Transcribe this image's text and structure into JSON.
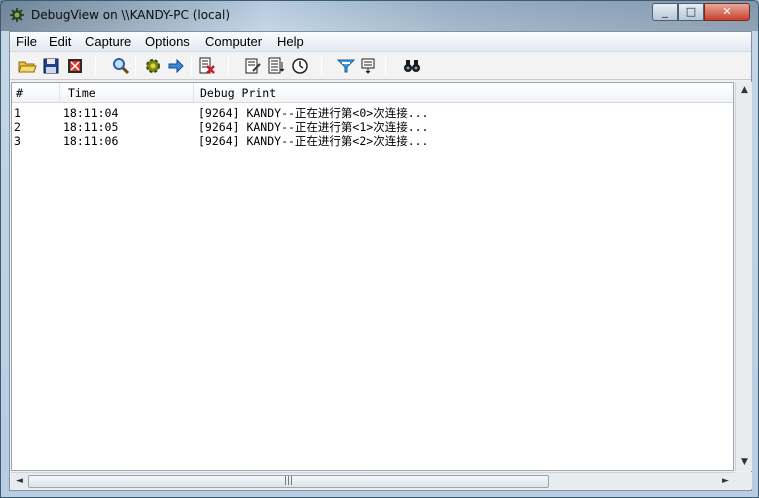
{
  "window": {
    "title": "DebugView on \\\\KANDY-PC (local)",
    "minimize": "0",
    "maximize": "1",
    "close": "r"
  },
  "menu": [
    "File",
    "Edit",
    "Capture",
    "Options",
    "Computer",
    "Help"
  ],
  "toolbar": {
    "icons": [
      "open-folder-icon",
      "save-icon",
      "clear-display-icon",
      "find-icon",
      "capture-settings-gear-icon",
      "autoscroll-arrow-icon",
      "clear-log-icon",
      "edit-filter-icon",
      "history-depth-icon",
      "time-clock-icon",
      "highlight-filter-icon",
      "options-icon",
      "binoculars-find-icon"
    ]
  },
  "table": {
    "headers": [
      "#",
      "Time",
      "Debug Print"
    ],
    "rows": [
      {
        "num": "1",
        "time": "18:11:04",
        "message": "[9264] KANDY--正在进行第<0>次连接..."
      },
      {
        "num": "2",
        "time": "18:11:05",
        "message": "[9264] KANDY--正在进行第<1>次连接..."
      },
      {
        "num": "3",
        "time": "18:11:06",
        "message": "[9264] KANDY--正在进行第<2>次连接..."
      }
    ]
  },
  "scrollbars": {
    "up_arrow": "▲",
    "down_arrow": "▼",
    "left_arrow": "◄",
    "right_arrow": "►",
    "thumb_grip": "|||"
  }
}
